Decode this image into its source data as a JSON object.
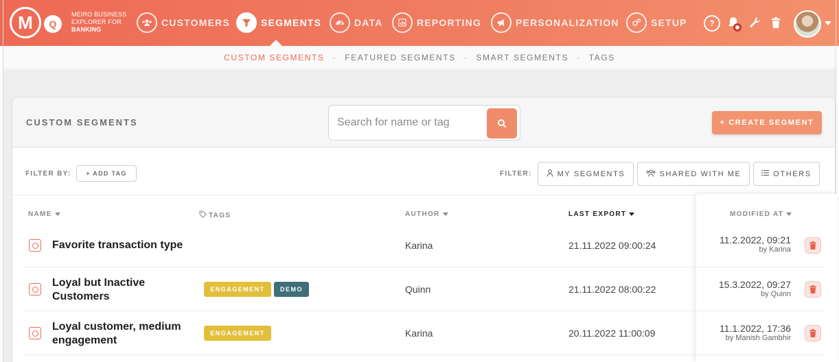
{
  "app": {
    "brand_line1": "MEIRO BUSINESS",
    "brand_line2": "EXPLORER FOR",
    "brand_line3": "BANKING",
    "logo_letter_m": "M",
    "logo_letter_q": "Q"
  },
  "nav": [
    {
      "label": "CUSTOMERS",
      "icon": "users-icon"
    },
    {
      "label": "SEGMENTS",
      "icon": "filter-icon",
      "active": true
    },
    {
      "label": "DATA",
      "icon": "gauge-icon"
    },
    {
      "label": "REPORTING",
      "icon": "chart-icon"
    },
    {
      "label": "PERSONALIZATION",
      "icon": "megaphone-icon"
    },
    {
      "label": "SETUP",
      "icon": "gears-icon"
    }
  ],
  "tools": {
    "help": "?"
  },
  "subnav": [
    "CUSTOM SEGMENTS",
    "FEATURED SEGMENTS",
    "SMART SEGMENTS",
    "TAGS"
  ],
  "subnav_sep": "·",
  "header": {
    "title": "CUSTOM SEGMENTS",
    "search_placeholder": "Search for name or tag",
    "create_label": "+ CREATE SEGMENT"
  },
  "filters": {
    "filter_by_label": "FILTER BY:",
    "add_tag_label": "+ ADD TAG",
    "filter_label": "FILTER:",
    "my_segments": "MY SEGMENTS",
    "shared_with_me": "SHARED WITH ME",
    "others": "OTHERS"
  },
  "table": {
    "columns": {
      "name": "NAME",
      "tags": "TAGS",
      "author": "AUTHOR",
      "last_export": "LAST EXPORT",
      "modified_at": "MODIFIED AT"
    },
    "rows": [
      {
        "name": "Favorite transaction type",
        "tags": [],
        "author": "Karina",
        "last_export": "21.11.2022 09:00:24",
        "modified": "11.2.2022, 09:21",
        "modified_by": "by Karina"
      },
      {
        "name": "Loyal but Inactive Customers",
        "tags": [
          "ENGAGEMENT",
          "DEMO"
        ],
        "author": "Quinn",
        "last_export": "21.11.2022 08:00:22",
        "modified": "15.3.2022, 09:27",
        "modified_by": "by Quinn"
      },
      {
        "name": "Loyal customer, medium engagement",
        "tags": [
          "ENGAGEMENT"
        ],
        "author": "Karina",
        "last_export": "20.11.2022 11:00:09",
        "modified": "11.1.2022, 17:36",
        "modified_by": "by Manish Gambhir"
      }
    ]
  },
  "colors": {
    "accent": "#ee6a55",
    "tag_engagement": "#e2bf3b",
    "tag_demo": "#3f6f78"
  }
}
